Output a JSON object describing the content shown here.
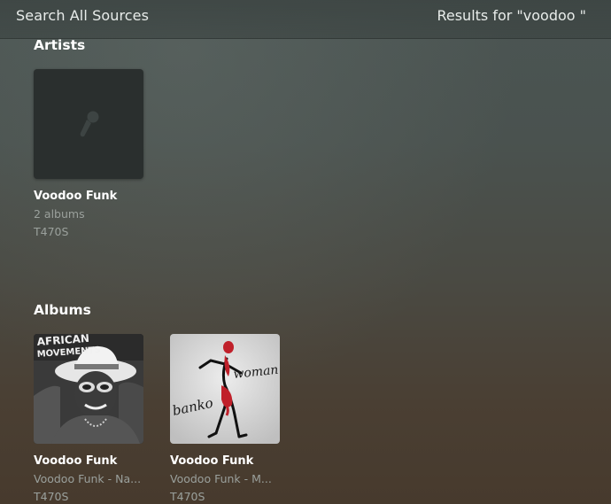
{
  "header": {
    "search_label": "Search All Sources",
    "results_label": "Results for \"voodoo \""
  },
  "artists": {
    "heading": "Artists",
    "items": [
      {
        "name": "Voodoo Funk",
        "albums": "2 albums",
        "source": "T470S",
        "icon": "microphone-icon"
      }
    ]
  },
  "albums": {
    "heading": "Albums",
    "items": [
      {
        "title": "Voodoo Funk",
        "subtitle": "Voodoo Funk - Na...",
        "source": "T470S",
        "art_text": [
          "AFRICAN",
          "MOVEMENTS"
        ]
      },
      {
        "title": "Voodoo Funk",
        "subtitle": "Voodoo Funk - M...",
        "source": "T470S",
        "art_text": [
          "banko",
          "woman"
        ]
      }
    ]
  },
  "colors": {
    "text_primary": "#ffffff",
    "text_secondary": "#9aa09c",
    "placeholder_bg": "#2a2f2e"
  }
}
